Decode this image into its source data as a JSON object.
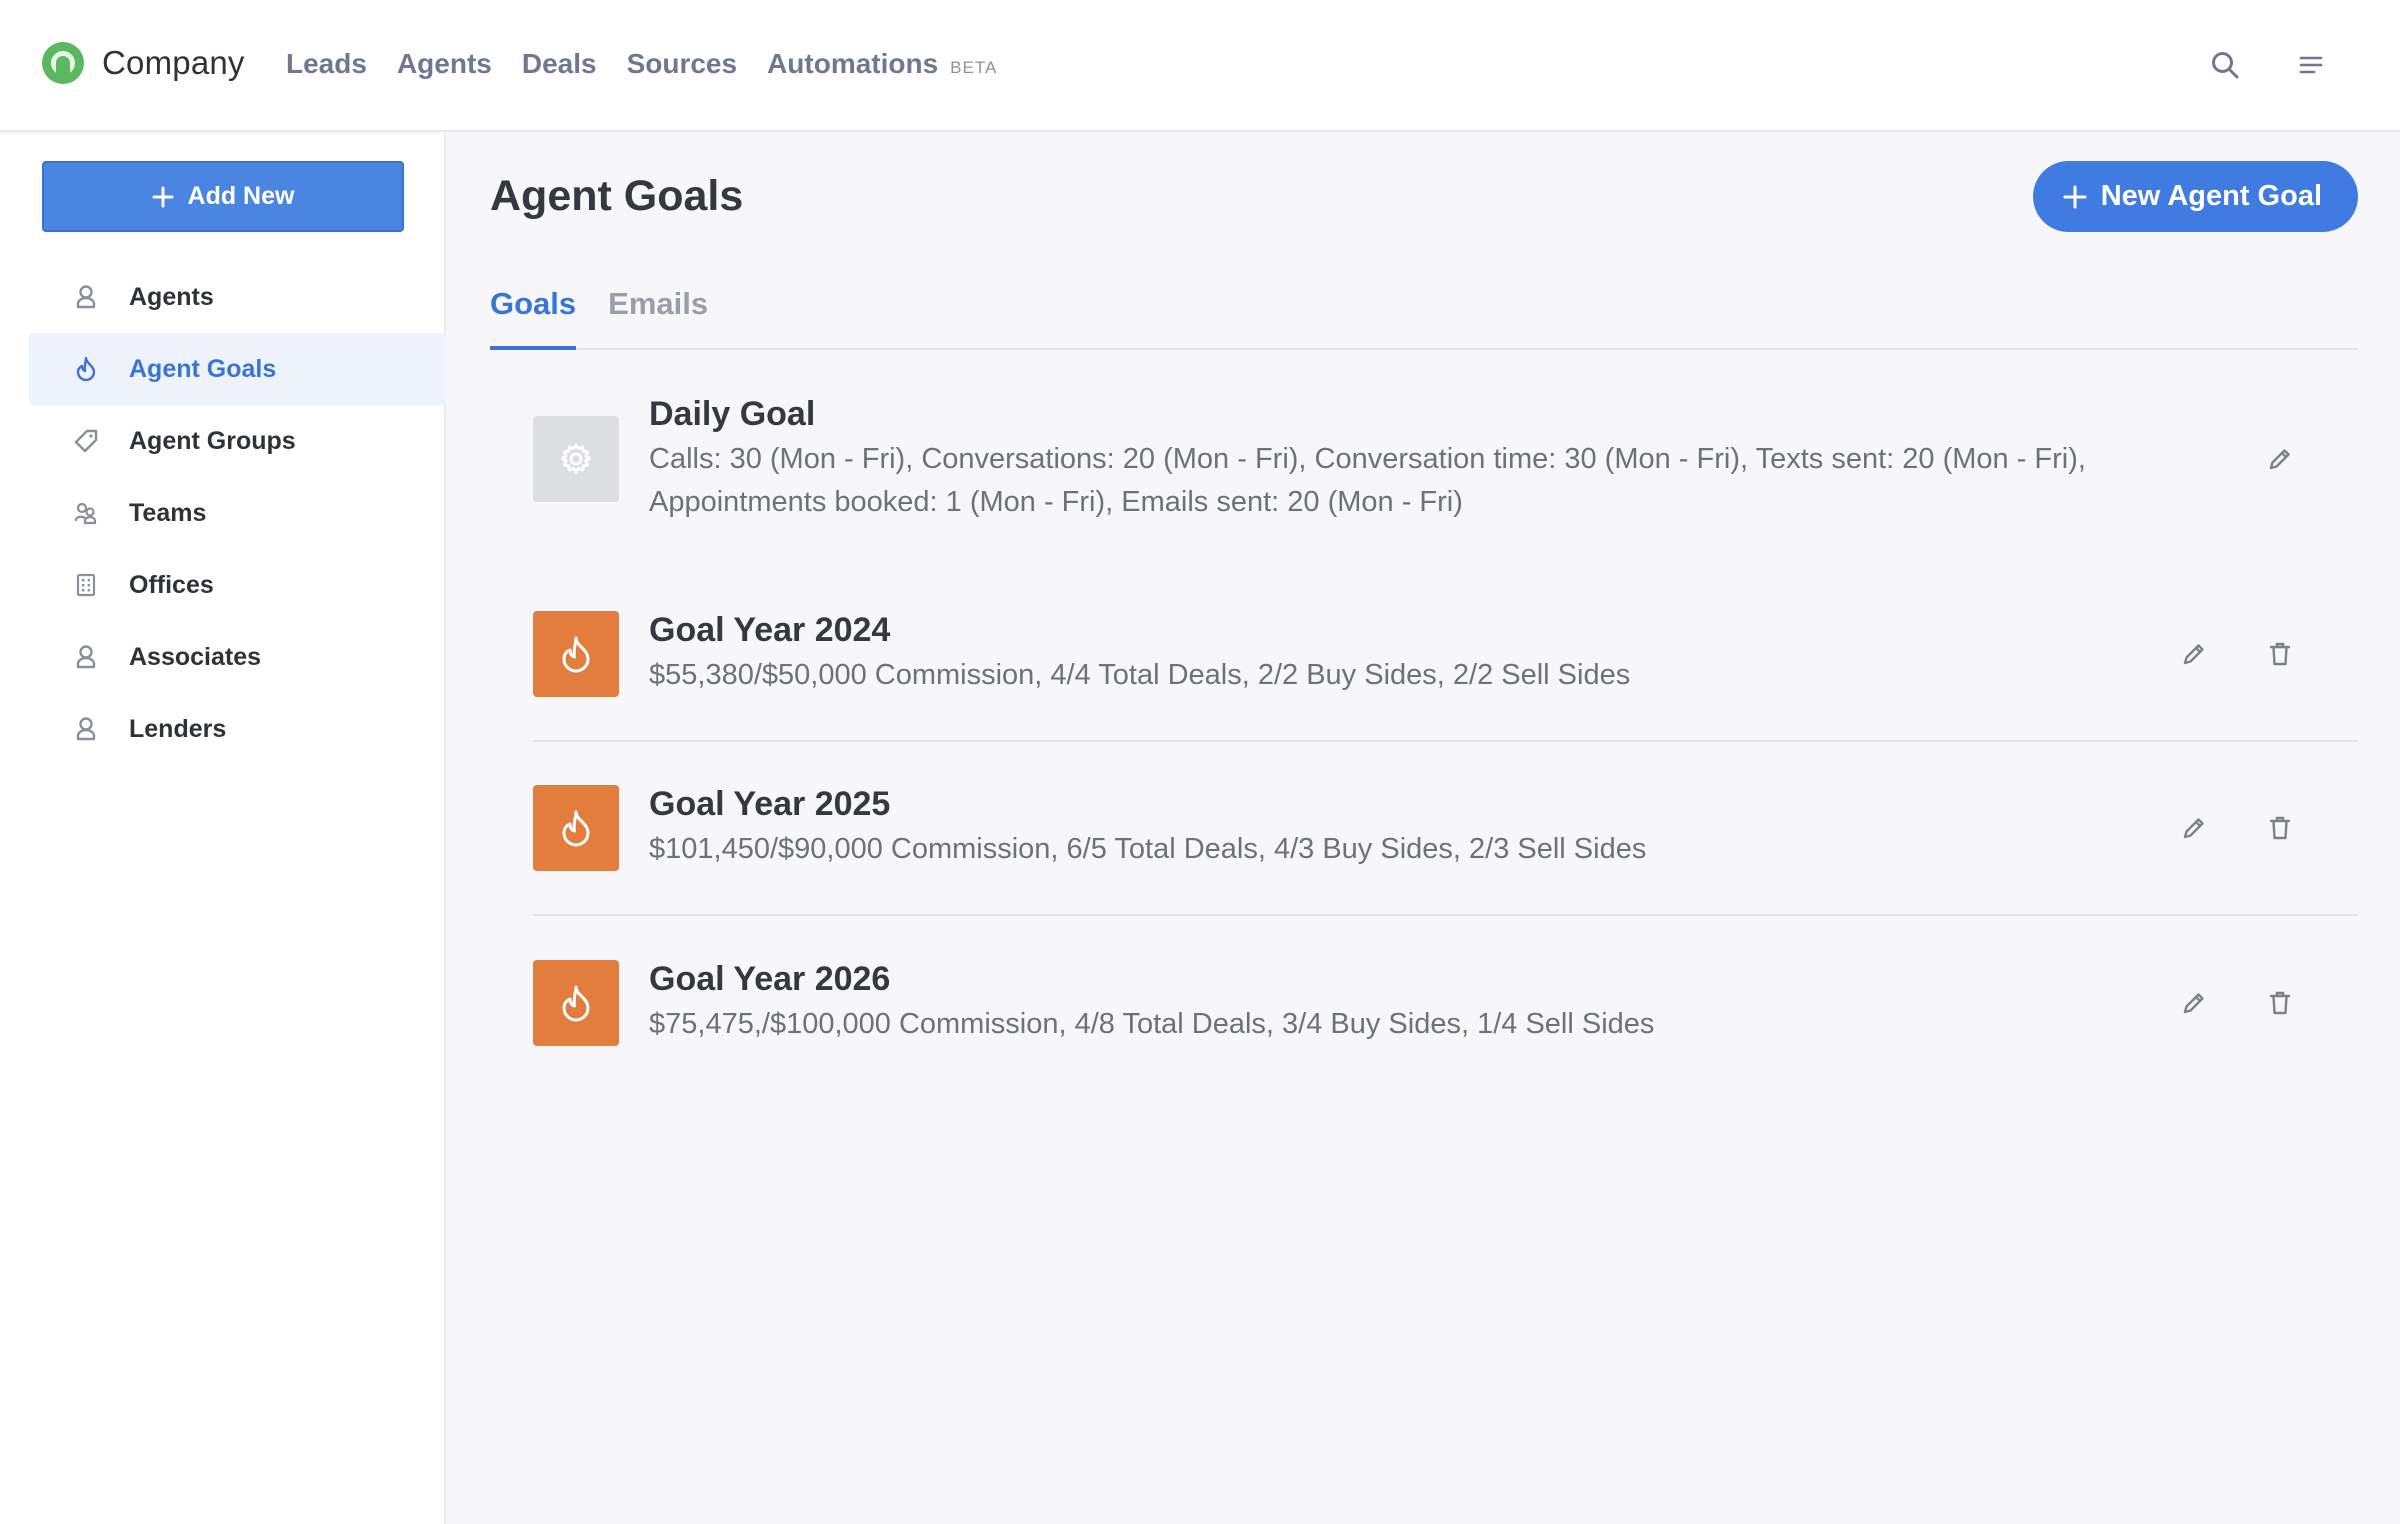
{
  "header": {
    "brand": "Company",
    "nav": [
      "Leads",
      "Agents",
      "Deals",
      "Sources",
      "Automations"
    ],
    "beta_label": "BETA"
  },
  "sidebar": {
    "add_new_label": "Add New",
    "items": [
      {
        "label": "Agents",
        "icon": "person-icon"
      },
      {
        "label": "Agent Goals",
        "icon": "flame-icon",
        "active": true
      },
      {
        "label": "Agent Groups",
        "icon": "tag-icon"
      },
      {
        "label": "Teams",
        "icon": "team-icon"
      },
      {
        "label": "Offices",
        "icon": "building-icon"
      },
      {
        "label": "Associates",
        "icon": "person-icon"
      },
      {
        "label": "Lenders",
        "icon": "person-icon"
      }
    ]
  },
  "main": {
    "title": "Agent Goals",
    "new_button_label": "New Agent Goal",
    "tabs": [
      {
        "label": "Goals",
        "active": true
      },
      {
        "label": "Emails",
        "active": false
      }
    ],
    "goals": [
      {
        "title": "Daily Goal",
        "description": "Calls: 30 (Mon - Fri), Conversations: 20 (Mon - Fri), Conversation time: 30 (Mon - Fri), Texts sent: 20 (Mon - Fri), Appointments booked: 1 (Mon - Fri), Emails sent: 20 (Mon - Fri)",
        "icon": "gear-icon"
      },
      {
        "title": "Goal Year 2024",
        "description": "$55,380/$50,000 Commission, 4/4 Total Deals, 2/2 Buy Sides, 2/2 Sell Sides",
        "icon": "flame-icon"
      },
      {
        "title": "Goal Year 2025",
        "description": "$101,450/$90,000 Commission, 6/5 Total Deals, 4/3 Buy Sides, 2/3 Sell Sides",
        "icon": "flame-icon"
      },
      {
        "title": "Goal Year 2026",
        "description": "$75,475,/$100,000 Commission, 4/8 Total Deals, 3/4 Buy Sides, 1/4 Sell Sides",
        "icon": "flame-icon"
      }
    ]
  },
  "colors": {
    "primary": "#3f7be0",
    "goal_orange": "#e27d3e",
    "active_text": "#3a74d6"
  }
}
